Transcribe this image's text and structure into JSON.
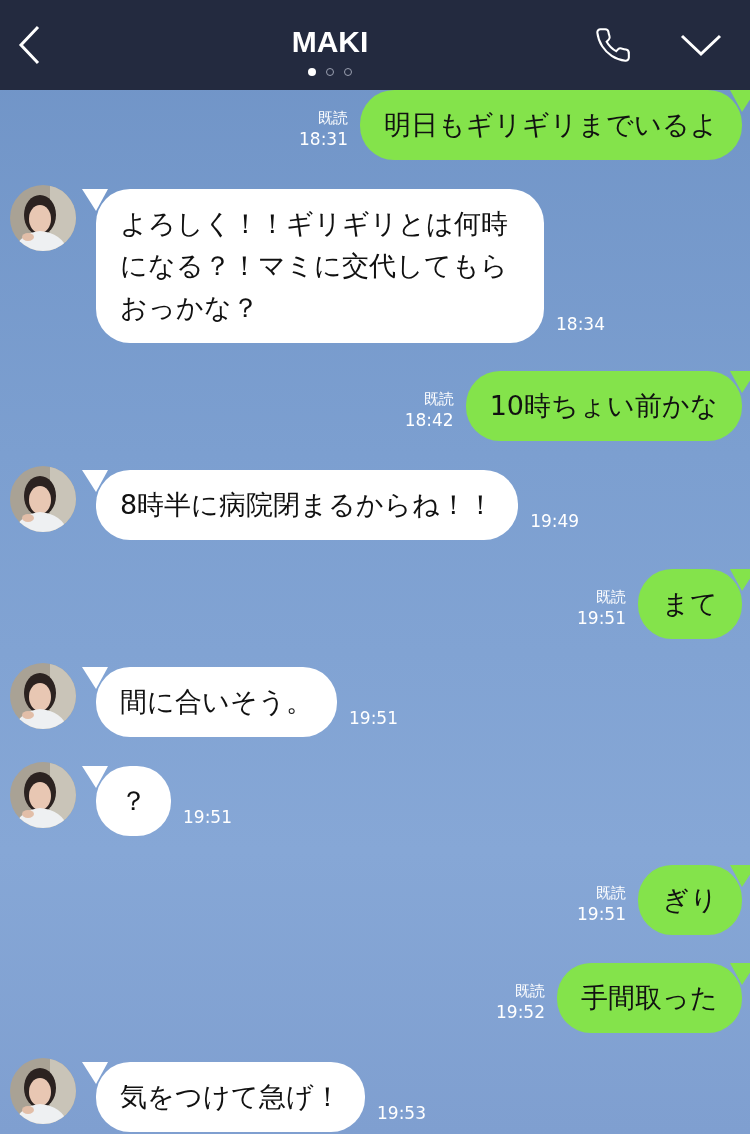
{
  "header": {
    "title": "MAKI",
    "pages": [
      {
        "selected": true
      },
      {
        "selected": false
      },
      {
        "selected": false
      }
    ]
  },
  "messages": [
    {
      "kind": "sent",
      "read": "既読",
      "time": "18:31",
      "text": "明日もギリギリまでいるよ"
    },
    {
      "kind": "received",
      "time": "18:34",
      "text": "よろしく！！ギリギリとは何時になる？！マミに交代してもらおっかな？"
    },
    {
      "kind": "sent",
      "read": "既読",
      "time": "18:42",
      "text": "10時ちょい前かな"
    },
    {
      "kind": "received",
      "time": "19:49",
      "text": "8時半に病院閉まるからね！！"
    },
    {
      "kind": "sent",
      "read": "既読",
      "time": "19:51",
      "text": "まて"
    },
    {
      "kind": "received",
      "time": "19:51",
      "text": "間に合いそう。"
    },
    {
      "kind": "received",
      "time": "19:51",
      "text": "？"
    },
    {
      "kind": "sent",
      "read": "既読",
      "time": "19:51",
      "text": "ぎり"
    },
    {
      "kind": "sent",
      "read": "既読",
      "time": "19:52",
      "text": "手間取った"
    },
    {
      "kind": "received",
      "time": "19:53",
      "text": "気をつけて急げ！"
    }
  ]
}
